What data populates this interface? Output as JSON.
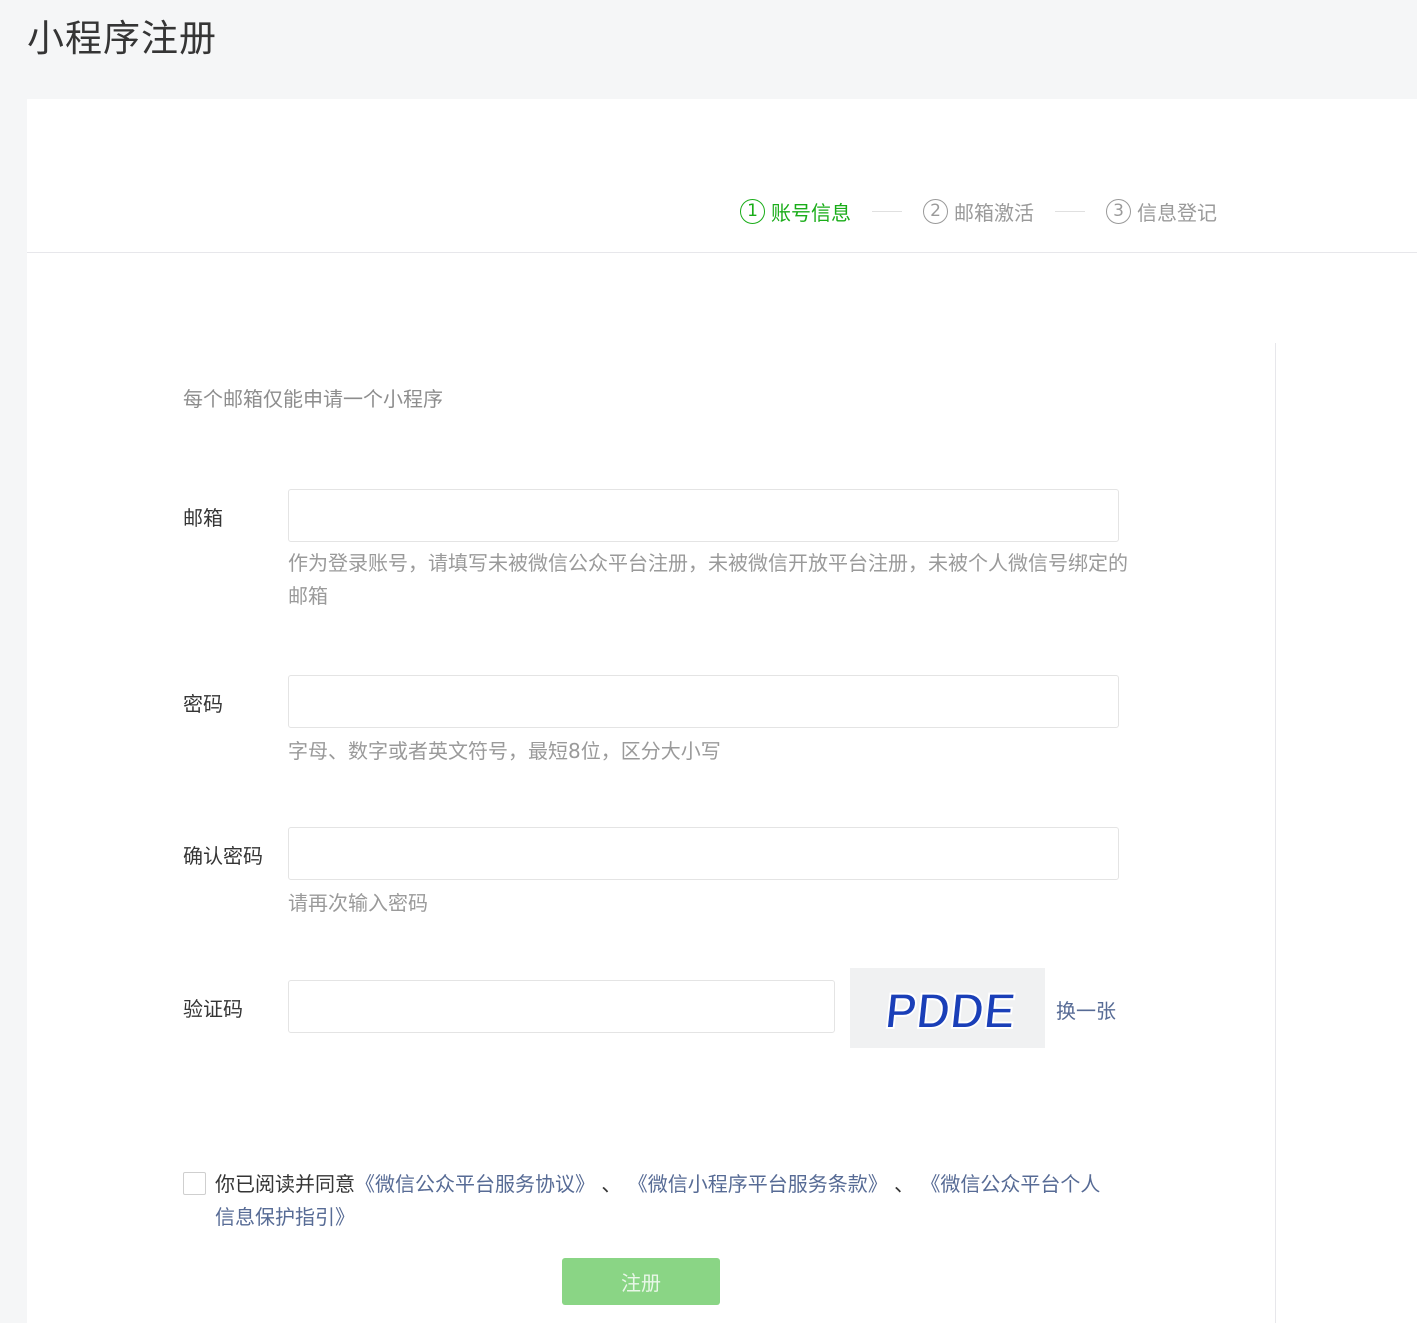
{
  "page": {
    "title": "小程序注册"
  },
  "steps": [
    {
      "num": "1",
      "label": "账号信息",
      "active": true
    },
    {
      "num": "2",
      "label": "邮箱激活",
      "active": false
    },
    {
      "num": "3",
      "label": "信息登记",
      "active": false
    }
  ],
  "form": {
    "notice": "每个邮箱仅能申请一个小程序",
    "email": {
      "label": "邮箱",
      "value": "",
      "tip": "作为登录账号，请填写未被微信公众平台注册，未被微信开放平台注册，未被个人微信号绑定的邮箱"
    },
    "password": {
      "label": "密码",
      "value": "",
      "tip": "字母、数字或者英文符号，最短8位，区分大小写"
    },
    "confirm_password": {
      "label": "确认密码",
      "value": "",
      "tip": "请再次输入密码"
    },
    "captcha": {
      "label": "验证码",
      "value": "",
      "image_text": "PDDE",
      "change_label": "换一张"
    },
    "agreement": {
      "checked": false,
      "prefix": "你已阅读并同意",
      "link1": "《微信公众平台服务协议》",
      "sep1": " 、",
      "link2": "《微信小程序平台服务条款》",
      "sep2": " 、",
      "link3": "《微信公众平台个人信息保护指引》"
    },
    "submit_label": "注册"
  },
  "colors": {
    "active_step": "#1aad19",
    "link": "#576b95",
    "submit_disabled": "#8ad585",
    "captcha_text": "#1a3fb8"
  }
}
